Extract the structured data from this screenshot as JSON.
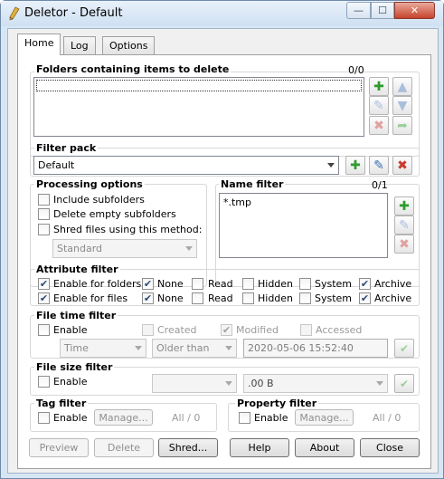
{
  "window": {
    "title": "Deletor - Default",
    "min": "—",
    "max": "☐",
    "close": "✕"
  },
  "tabs": [
    {
      "label": "Home"
    },
    {
      "label": "Log"
    },
    {
      "label": "Options"
    }
  ],
  "folders": {
    "title": "Folders containing items to delete",
    "count": "0/0"
  },
  "filter_pack": {
    "title": "Filter pack",
    "selected": "Default"
  },
  "processing": {
    "title": "Processing options",
    "include_subfolders": "Include subfolders",
    "delete_empty": "Delete empty subfolders",
    "shred": "Shred files using this method:",
    "method": "Standard"
  },
  "name_filter": {
    "title": "Name filter",
    "count": "0/1",
    "items": [
      "*.tmp"
    ]
  },
  "attribute_filter": {
    "title": "Attribute filter",
    "rows": [
      {
        "label": "Enable for folders",
        "enabled": true,
        "none": true,
        "read": false,
        "hidden": false,
        "system": false,
        "archive": true
      },
      {
        "label": "Enable for files",
        "enabled": true,
        "none": true,
        "read": false,
        "hidden": false,
        "system": false,
        "archive": true
      }
    ],
    "none": "None",
    "read": "Read",
    "hidden": "Hidden",
    "system": "System",
    "archive": "Archive"
  },
  "file_time": {
    "title": "File time filter",
    "enable": "Enable",
    "created": "Created",
    "modified": "Modified",
    "accessed": "Accessed",
    "type": "Time",
    "comparison": "Older than",
    "datetime": "2020-05-06 15:52:40"
  },
  "file_size": {
    "title": "File size filter",
    "enable": "Enable",
    "comparison": "",
    "value": ".00 B"
  },
  "tag_filter": {
    "title": "Tag filter",
    "enable": "Enable",
    "manage": "Manage...",
    "count": "All / 0"
  },
  "property_filter": {
    "title": "Property filter",
    "enable": "Enable",
    "manage": "Manage...",
    "count": "All / 0"
  },
  "buttons": {
    "preview": "Preview",
    "delete": "Delete",
    "shred": "Shred...",
    "help": "Help",
    "about": "About",
    "close": "Close"
  },
  "icons": {
    "check": "✔",
    "add": "✚",
    "edit": "✎",
    "remove": "✖",
    "up": "▲",
    "down": "▼",
    "go": "➦"
  }
}
